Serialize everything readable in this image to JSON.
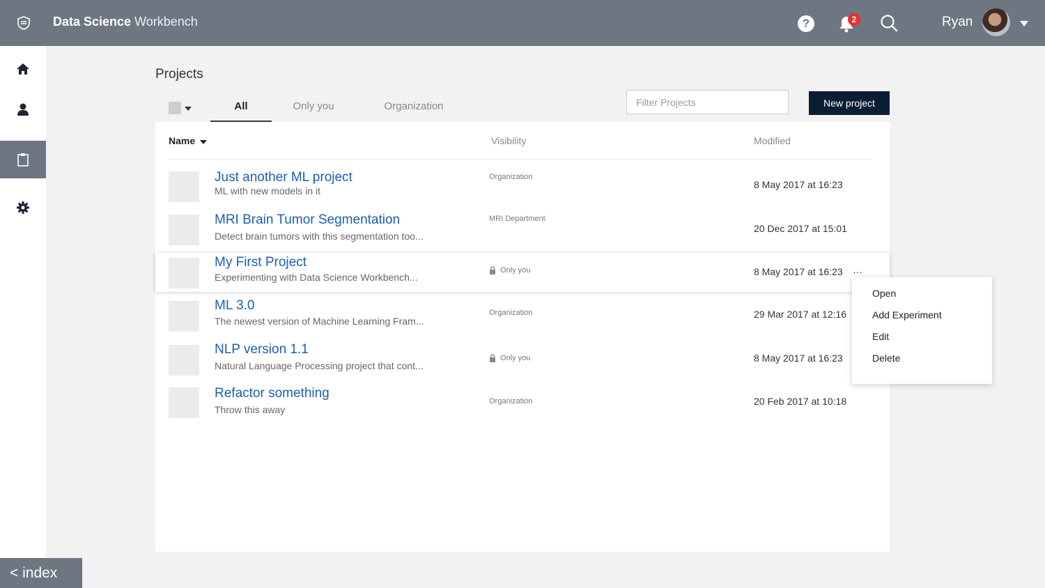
{
  "header": {
    "app_title_bold": "Data Science",
    "app_title_rest": "Workbench",
    "help_glyph": "?",
    "notification_count": "2",
    "username": "Ryan"
  },
  "sidebar": {
    "items": [
      {
        "icon": "home-icon"
      },
      {
        "icon": "user-icon"
      },
      {
        "icon": "clipboard-icon",
        "active": true
      },
      {
        "icon": "gear-icon"
      }
    ]
  },
  "main": {
    "page_title": "Projects",
    "tabs": [
      {
        "label": "All",
        "active": true
      },
      {
        "label": "Only you"
      },
      {
        "label": "Organization"
      }
    ],
    "filter_placeholder": "Filter Projects",
    "new_project_label": "New project",
    "columns": {
      "name": "Name",
      "visibility": "Visibility",
      "modified": "Modified"
    },
    "projects": [
      {
        "title": "Just another ML project",
        "desc": "ML with new models in it",
        "visibility": "Organization",
        "locked": false,
        "modified": "8 May 2017 at 16:23"
      },
      {
        "title": "MRI Brain Tumor Segmentation",
        "desc": "Detect brain tumors with this segmentation too...",
        "visibility": "MRI Department",
        "locked": false,
        "modified": "20 Dec 2017 at 15:01"
      },
      {
        "title": "My First Project",
        "desc": "Experimenting with Data Science Workbench...",
        "visibility": "Only you",
        "locked": true,
        "modified": "8 May 2017 at 16:23",
        "more": "…"
      },
      {
        "title": "ML 3.0",
        "desc": "The newest version of Machine Learning Fram...",
        "visibility": "Organization",
        "locked": false,
        "modified": "29 Mar 2017 at 12:16"
      },
      {
        "title": "NLP version 1.1",
        "desc": "Natural Language Processing project that cont...",
        "visibility": "Only you",
        "locked": true,
        "modified": "8 May 2017 at 16:23"
      },
      {
        "title": "Refactor something",
        "desc": "Throw this away",
        "visibility": "Organization",
        "locked": false,
        "modified": "20 Feb 2017 at 10:18"
      }
    ],
    "context_menu": [
      "Open",
      "Add Experiment",
      "Edit",
      "Delete"
    ]
  },
  "footer": {
    "index_label": "< index"
  },
  "colors": {
    "topbar": "#6e7682",
    "link": "#1a5fb4",
    "button": "#0b1d33",
    "badge": "#e8302f"
  }
}
